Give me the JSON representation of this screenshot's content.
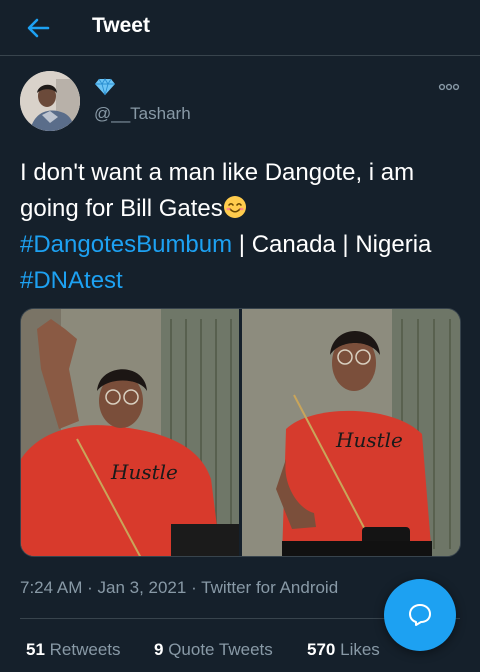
{
  "header": {
    "title": "Tweet",
    "back_icon": "back-arrow-icon",
    "accent": "#1da1f2"
  },
  "author": {
    "name_icon": "gem-icon",
    "handle": "@__Tasharh",
    "avatar_icon": "avatar"
  },
  "tweet": {
    "line1": "I don't want a man like Dangote, i am going for Bill Gates",
    "emoji": "smiling-face-icon",
    "hashtag1": "#DangotesBumbum",
    "middle": " | Canada | Nigeria ",
    "hashtag2": "#DNAtest"
  },
  "meta": {
    "time": "7:24 AM",
    "sep1": " · ",
    "date": "Jan 3, 2021",
    "sep2": " · ",
    "source": "Twitter for Android"
  },
  "stats": {
    "retweets_count": "51",
    "retweets_label": "Retweets",
    "quotes_count": "9",
    "quotes_label": "Quote Tweets",
    "likes_count": "570",
    "likes_label": "Likes"
  },
  "colors": {
    "background": "#15202b",
    "secondary_text": "#8899a6",
    "border": "#38444d"
  }
}
